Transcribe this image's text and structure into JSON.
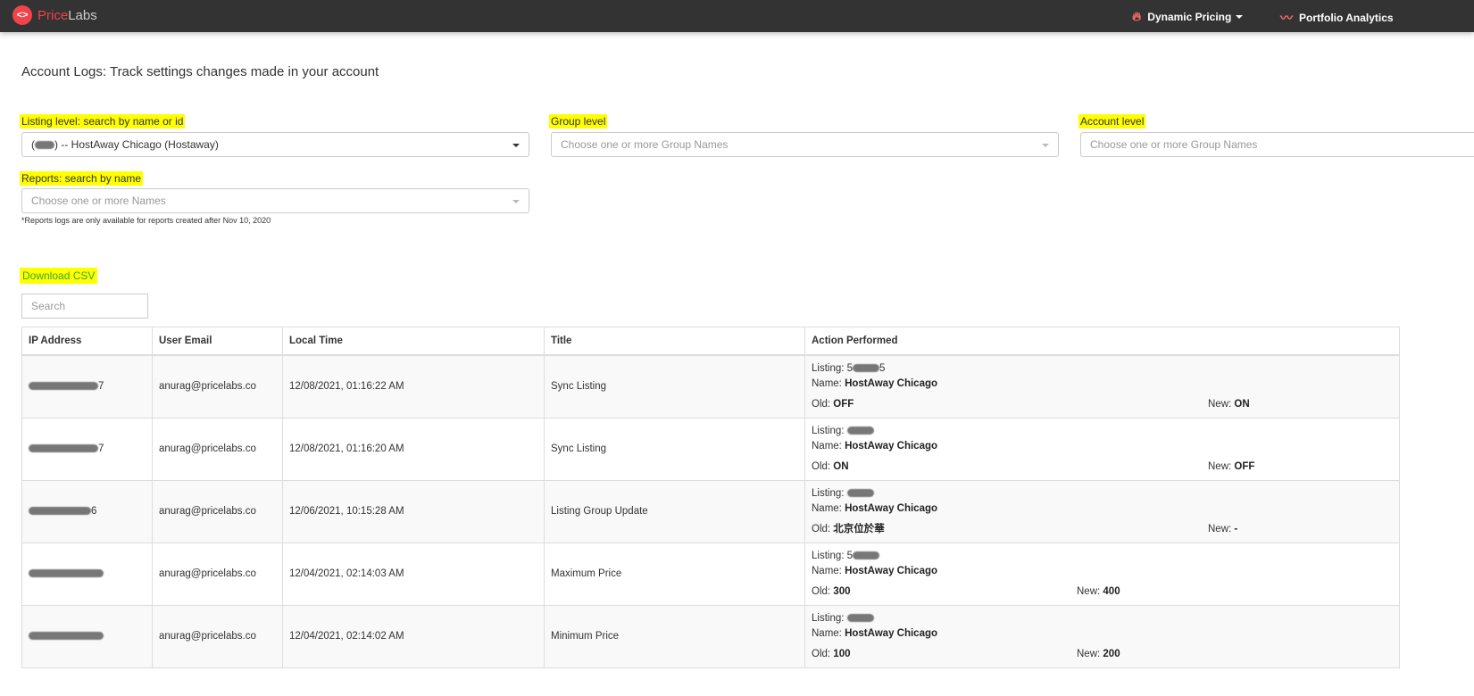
{
  "header": {
    "brand_a": "Price",
    "brand_b": "Labs",
    "logo_mark": "<>",
    "nav": [
      {
        "label": "Dynamic Pricing",
        "icon": "flame-icon"
      },
      {
        "label": "Portfolio Analytics",
        "icon": "trend-chart-icon"
      }
    ]
  },
  "page_title": "Account Logs: Track settings changes made in your account",
  "filters": {
    "listing": {
      "label": "Listing level: search by name or id",
      "value_prefix": "(",
      "value": ") -- HostAway Chicago (Hostaway)"
    },
    "group": {
      "label": "Group level",
      "placeholder": "Choose one or more Group Names"
    },
    "account": {
      "label": "Account level",
      "placeholder": "Choose one or more Group Names"
    },
    "reports": {
      "label": "Reports: search by name",
      "placeholder": "Choose one or more Names",
      "note": "*Reports logs are only available for reports created after Nov 10, 2020"
    }
  },
  "download_csv": "Download CSV",
  "search": {
    "placeholder": "Search"
  },
  "table": {
    "headers": [
      "IP Address",
      "User Email",
      "Local Time",
      "Title",
      "Action Performed"
    ],
    "rows": [
      {
        "ip_suffix": "7",
        "email": "anurag@pricelabs.co",
        "time": "12/08/2021, 01:16:22 AM",
        "title": "Sync Listing",
        "listing_prefix": "5",
        "listing_suffix": "5",
        "name": "HostAway Chicago",
        "old": "OFF",
        "new": "ON"
      },
      {
        "ip_suffix": "7",
        "email": "anurag@pricelabs.co",
        "time": "12/08/2021, 01:16:20 AM",
        "title": "Sync Listing",
        "listing_prefix": "",
        "listing_suffix": "",
        "name": "HostAway Chicago",
        "old": "ON",
        "new": "OFF"
      },
      {
        "ip_suffix": "6",
        "email": "anurag@pricelabs.co",
        "time": "12/06/2021, 10:15:28 AM",
        "title": "Listing Group Update",
        "listing_prefix": "",
        "listing_suffix": "",
        "name": "HostAway Chicago",
        "old": "北京位於華",
        "new": "-"
      },
      {
        "ip_suffix": "",
        "email": "anurag@pricelabs.co",
        "time": "12/04/2021, 02:14:03 AM",
        "title": "Maximum Price",
        "listing_prefix": "5",
        "listing_suffix": "",
        "name": "HostAway Chicago",
        "old": "300",
        "new": "400"
      },
      {
        "ip_suffix": "",
        "email": "anurag@pricelabs.co",
        "time": "12/04/2021, 02:14:02 AM",
        "title": "Minimum Price",
        "listing_prefix": "",
        "listing_suffix": "",
        "name": "HostAway Chicago",
        "old": "100",
        "new": "200"
      }
    ],
    "labels": {
      "listing": "Listing: ",
      "name": "Name: ",
      "old": "Old: ",
      "new": "New: "
    }
  }
}
